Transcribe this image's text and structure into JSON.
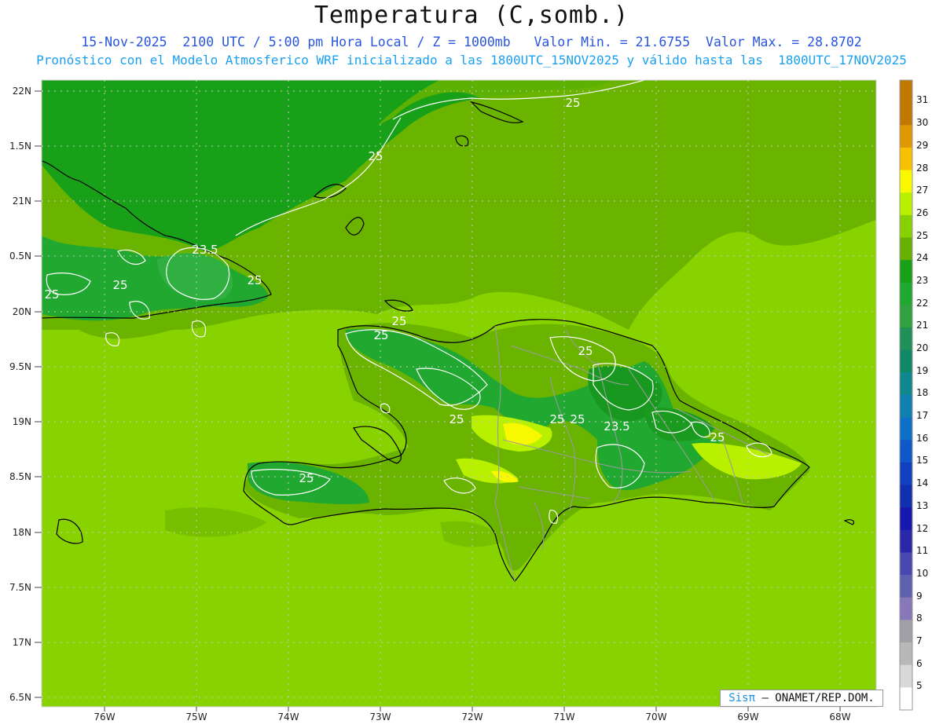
{
  "header": {
    "title": "Temperatura (C,somb.)",
    "subtitle_1": "15-Nov-2025  2100 UTC / 5:00 pm Hora Local / Z = 1000mb   Valor Min. = 21.6755  Valor Max. = 28.8702",
    "subtitle_2": "Pronóstico con el Modelo Atmosferico WRF inicializado a las 1800UTC_15NOV2025 y válido hasta las  1800UTC_17NOV2025"
  },
  "axes": {
    "lat_labels": [
      "22N",
      "1.5N",
      "21N",
      "0.5N",
      "20N",
      "9.5N",
      "19N",
      "8.5N",
      "18N",
      "7.5N",
      "17N",
      "6.5N"
    ],
    "lon_labels": [
      "76W",
      "75W",
      "74W",
      "73W",
      "72W",
      "71W",
      "70W",
      "69W",
      "68W"
    ]
  },
  "colorbar": {
    "labels": [
      "31",
      "30",
      "29",
      "28",
      "27",
      "26",
      "25",
      "24",
      "23",
      "22",
      "21",
      "20",
      "19",
      "18",
      "17",
      "16",
      "15",
      "14",
      "13",
      "12",
      "11",
      "10",
      "9",
      "8",
      "7",
      "6",
      "5"
    ],
    "colors": [
      "#c07800",
      "#e09800",
      "#f8c000",
      "#f8f800",
      "#b8f000",
      "#88d000",
      "#68b000",
      "#18a018",
      "#20a830",
      "#30a040",
      "#209058",
      "#108868",
      "#108890",
      "#1080b0",
      "#1070c8",
      "#1058c8",
      "#1040c0",
      "#1030b0",
      "#1818b0",
      "#2828a8",
      "#4848b0",
      "#6060b0",
      "#8878b8",
      "#a0a0a8",
      "#b8b8b8",
      "#d8d8d8",
      "#ffffff"
    ]
  },
  "contour_labels": [
    "25",
    "25",
    "23.5",
    "25",
    "25",
    "25",
    "25",
    "25",
    "25",
    "25",
    "25",
    "25",
    "23.5",
    "25",
    "25"
  ],
  "credit": {
    "prefix": "Sis",
    "pi": "π",
    "text": "– ONAMET/REP.DOM."
  }
}
